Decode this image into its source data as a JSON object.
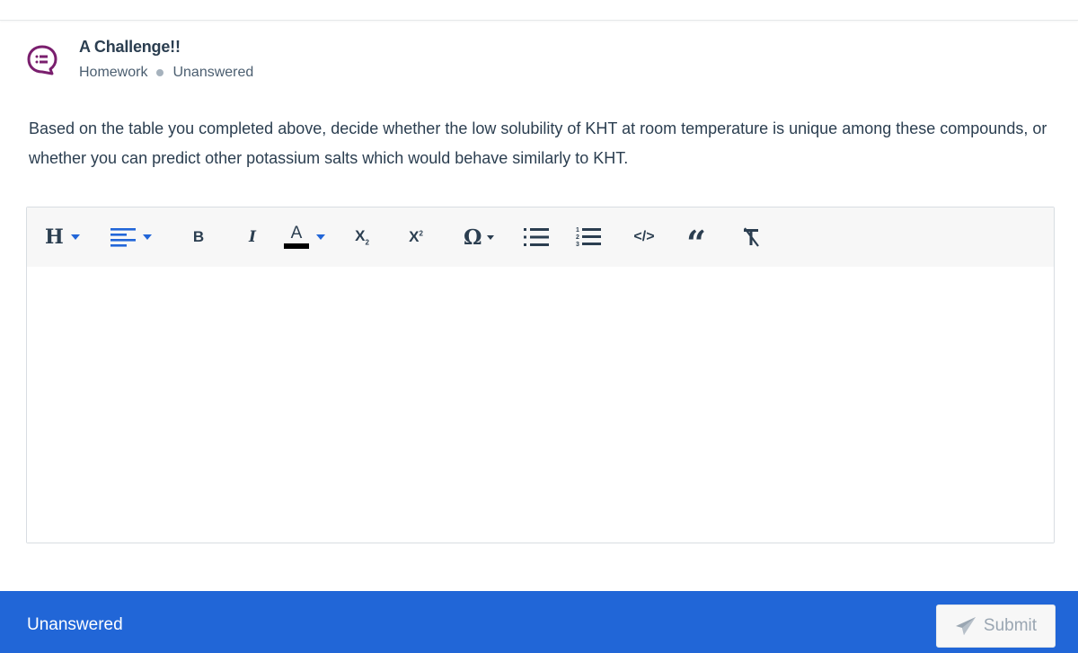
{
  "header": {
    "icon": "question-bubble-icon",
    "title": "A Challenge!!",
    "category": "Homework",
    "status": "Unanswered"
  },
  "question": {
    "text": "Based on the table you completed above, decide whether the low solubility of KHT at room temperature is unique among these compounds, or whether you can predict other potassium salts which would behave similarly to KHT."
  },
  "editor": {
    "toolbar": [
      {
        "name": "heading",
        "icon": "heading-icon",
        "glyph": "H",
        "dropdown": true
      },
      {
        "name": "align",
        "icon": "align-left-icon",
        "dropdown": true
      },
      {
        "name": "bold",
        "icon": "bold-icon",
        "glyph": "B"
      },
      {
        "name": "italic",
        "icon": "italic-icon",
        "glyph": "I"
      },
      {
        "name": "text-color",
        "icon": "text-color-icon",
        "glyph": "A",
        "dropdown": true
      },
      {
        "name": "subscript",
        "icon": "subscript-icon",
        "glyph": "X",
        "sub": "2"
      },
      {
        "name": "superscript",
        "icon": "superscript-icon",
        "glyph": "X",
        "sup": "2"
      },
      {
        "name": "special-chars",
        "icon": "omega-icon",
        "glyph": "Ω",
        "dropdown": true
      },
      {
        "name": "bullet-list",
        "icon": "bullet-list-icon"
      },
      {
        "name": "numbered-list",
        "icon": "numbered-list-icon"
      },
      {
        "name": "code",
        "icon": "code-icon",
        "glyph": "</>"
      },
      {
        "name": "blockquote",
        "icon": "quote-icon",
        "glyph": "“"
      },
      {
        "name": "clear-format",
        "icon": "clear-format-icon",
        "glyph": "T"
      }
    ],
    "content": ""
  },
  "colors": {
    "accent": "#2166d7",
    "icon_purple": "#7a1f6e",
    "text": "#2b3e50"
  },
  "footer": {
    "status": "Unanswered",
    "submit_label": "Submit",
    "submit_icon": "paper-plane-icon"
  }
}
